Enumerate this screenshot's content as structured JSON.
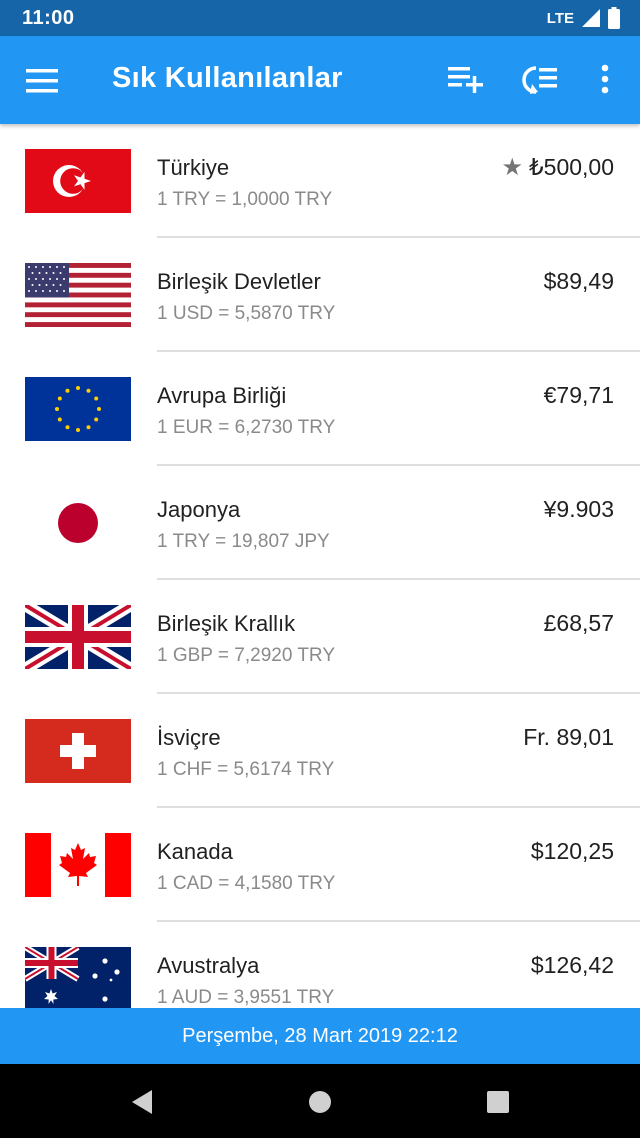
{
  "status_bar": {
    "time": "11:00",
    "network": "LTE"
  },
  "app_bar": {
    "title": "Sık Kullanılanlar",
    "icons": [
      "menu-icon",
      "playlist-add-icon",
      "reorder-icon",
      "more-vert-icon"
    ]
  },
  "currencies": [
    {
      "country": "Türkiye",
      "rate": "1 TRY = 1,0000 TRY",
      "amount": "₺500,00",
      "starred": true,
      "flag": "turkey"
    },
    {
      "country": "Birleşik Devletler",
      "rate": "1 USD = 5,5870 TRY",
      "amount": "$89,49",
      "flag": "usa"
    },
    {
      "country": "Avrupa Birliği",
      "rate": "1 EUR = 6,2730 TRY",
      "amount": "€79,71",
      "flag": "eu"
    },
    {
      "country": "Japonya",
      "rate": "1 TRY = 19,807 JPY",
      "amount": "¥9.903",
      "flag": "japan"
    },
    {
      "country": "Birleşik Krallık",
      "rate": "1 GBP = 7,2920 TRY",
      "amount": "£68,57",
      "flag": "uk"
    },
    {
      "country": "İsviçre",
      "rate": "1 CHF = 5,6174 TRY",
      "amount": "Fr. 89,01",
      "flag": "switzerland"
    },
    {
      "country": "Kanada",
      "rate": "1 CAD = 4,1580 TRY",
      "amount": "$120,25",
      "flag": "canada"
    },
    {
      "country": "Avustralya",
      "rate": "1 AUD = 3,9551 TRY",
      "amount": "$126,42",
      "flag": "australia"
    }
  ],
  "footer": {
    "date": "Perşembe, 28 Mart 2019 22:12"
  },
  "colors": {
    "primary": "#2196f3",
    "status_bar": "#1565a8",
    "text": "#212121",
    "secondary_text": "#8a8a8a"
  }
}
